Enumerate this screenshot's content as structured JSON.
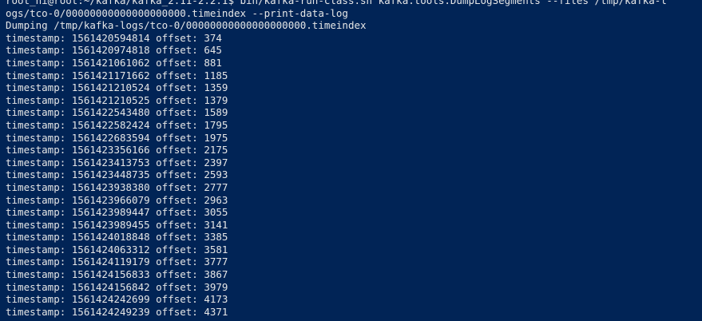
{
  "terminal": {
    "lines": [
      "root_hi@root:~/kafka/kafka_2.11-2.2.1$ bin/kafka-run-class.sh kafka.tools.DumpLogSegments --files /tmp/kafka-l",
      "ogs/tco-0/00000000000000000000.timeindex --print-data-log",
      "Dumping /tmp/kafka-logs/tco-0/00000000000000000000.timeindex",
      "timestamp: 1561420594814 offset: 374",
      "timestamp: 1561420974818 offset: 645",
      "timestamp: 1561421061062 offset: 881",
      "timestamp: 1561421171662 offset: 1185",
      "timestamp: 1561421210524 offset: 1359",
      "timestamp: 1561421210525 offset: 1379",
      "timestamp: 1561422543480 offset: 1589",
      "timestamp: 1561422582424 offset: 1795",
      "timestamp: 1561422683594 offset: 1975",
      "timestamp: 1561423356166 offset: 2175",
      "timestamp: 1561423413753 offset: 2397",
      "timestamp: 1561423448735 offset: 2593",
      "timestamp: 1561423938380 offset: 2777",
      "timestamp: 1561423966079 offset: 2963",
      "timestamp: 1561423989447 offset: 3055",
      "timestamp: 1561423989455 offset: 3141",
      "timestamp: 1561424018848 offset: 3385",
      "timestamp: 1561424063312 offset: 3581",
      "timestamp: 1561424119179 offset: 3777",
      "timestamp: 1561424156833 offset: 3867",
      "timestamp: 1561424156842 offset: 3979",
      "timestamp: 1561424242699 offset: 4173",
      "timestamp: 1561424249239 offset: 4371"
    ]
  },
  "colors": {
    "background": "#012456",
    "foreground": "#e6e6e6"
  }
}
